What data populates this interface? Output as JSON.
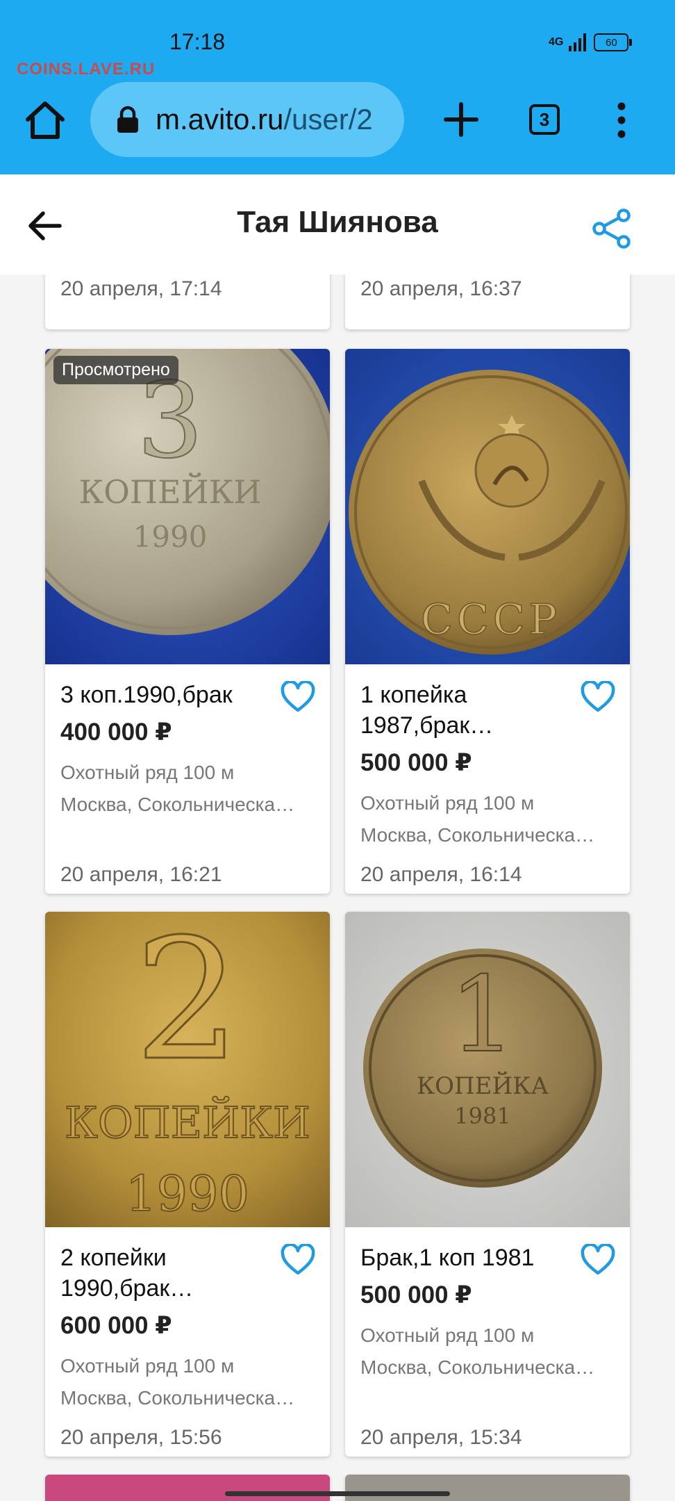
{
  "status_bar": {
    "time": "17:18",
    "network": "4G",
    "battery": "60"
  },
  "watermark": "COINS.LAVE.RU",
  "browser": {
    "url_host": "m.avito.ru",
    "url_path": "/user/2",
    "tab_count": "3",
    "accent_color": "#1eaaf1"
  },
  "header": {
    "title": "Тая Шиянова"
  },
  "top_row": [
    {
      "date": "20 апреля, 17:14"
    },
    {
      "date": "20 апреля, 16:37"
    }
  ],
  "listings": [
    {
      "badge": "Просмотрено",
      "title": "3 коп.1990,брак",
      "price": "400 000 ₽",
      "address": "Охотный ряд 100 м",
      "city": "Москва, Сокольническа…",
      "date": "20 апреля, 16:21",
      "coin_text": [
        "3",
        "КОПЕЙКИ",
        "1990"
      ]
    },
    {
      "title": "1 копейка 1987,брак…",
      "price": "500 000 ₽",
      "address": "Охотный ряд 100 м",
      "city": "Москва, Сокольническа…",
      "date": "20 апреля, 16:14",
      "coin_text": [
        "СССР"
      ]
    },
    {
      "title": "2 копейки 1990,брак…",
      "price": "600 000 ₽",
      "address": "Охотный ряд 100 м",
      "city": "Москва, Сокольническа…",
      "date": "20 апреля, 15:56",
      "coin_text": [
        "2",
        "КОПЕЙКИ",
        "1990"
      ]
    },
    {
      "title": "Брак,1 коп 1981",
      "price": "500 000 ₽",
      "address": "Охотный ряд 100 м",
      "city": "Москва, Сокольническа…",
      "date": "20 апреля, 15:34",
      "coin_text": [
        "1",
        "КОПЕЙКА",
        "1981"
      ]
    }
  ]
}
